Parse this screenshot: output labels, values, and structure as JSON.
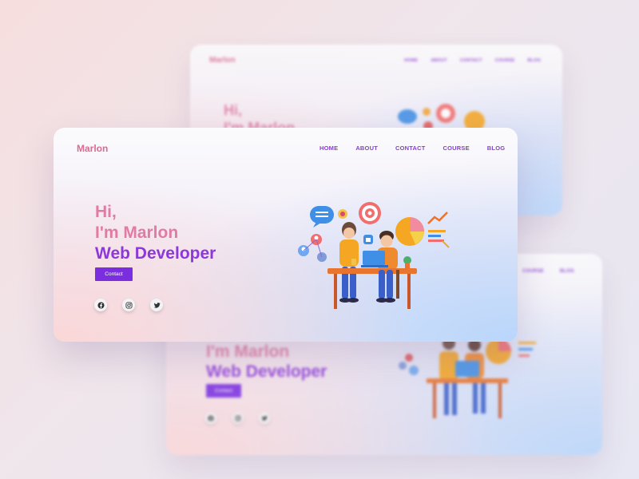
{
  "brand": {
    "name": "Marlon"
  },
  "nav": {
    "items": [
      "HOME",
      "ABOUT",
      "CONTACT",
      "COURSE",
      "BLOG"
    ]
  },
  "hero": {
    "line1": "Hi,",
    "line2": "I'm Marlon",
    "line3": "Web Developer",
    "cta_label": "Contact"
  },
  "social": [
    "facebook-icon",
    "instagram-icon",
    "twitter-icon"
  ],
  "colors": {
    "brand_pink": "#d86c92",
    "accent_purple": "#8d38da",
    "button_purple": "#7b2ee0"
  }
}
